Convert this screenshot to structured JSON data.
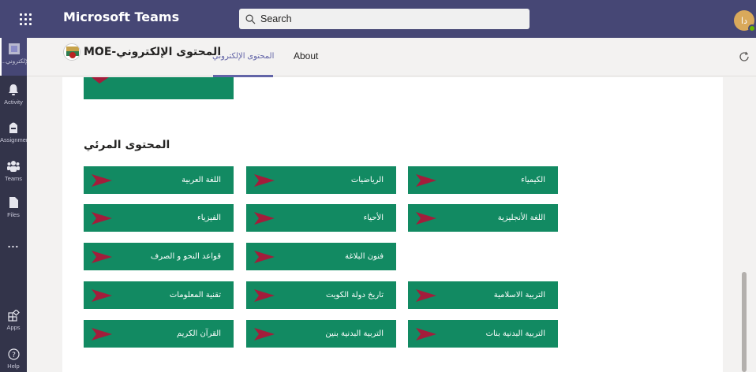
{
  "app": {
    "title": "Microsoft Teams"
  },
  "search": {
    "placeholder": "Search"
  },
  "user": {
    "initials": "دا"
  },
  "rail": {
    "items": [
      {
        "label": "...نوى الإلكتروني"
      },
      {
        "label": "Activity"
      },
      {
        "label": "Assignments"
      },
      {
        "label": "Teams"
      },
      {
        "label": "Files"
      },
      {
        "label": "..."
      },
      {
        "label": "Apps"
      },
      {
        "label": "Help"
      }
    ]
  },
  "header": {
    "team_title": "المحتوى الإلكتروني-MOE",
    "tabs": [
      {
        "label": "المحتوى الإلكتروني",
        "active": true
      },
      {
        "label": "About",
        "active": false
      }
    ]
  },
  "main": {
    "section_title": "المحتوى المرئي",
    "subjects": [
      "اللغة العربية",
      "الرياضيات",
      "الكيمياء",
      "الفيزياء",
      "الأحياء",
      "اللغة الأنجليزية",
      "قواعد النحو و الصرف",
      "فنون البلاغة",
      "تقنية المعلومات",
      "تاريخ دولة الكويت",
      "التربية الاسلامية",
      "القرآن الكريم",
      "التربية البدنية بنين",
      "التربية البدنية بنات"
    ]
  },
  "colors": {
    "topbar": "#464775",
    "rail": "#33344a",
    "tile": "#128a62",
    "accent": "#6264a7"
  }
}
